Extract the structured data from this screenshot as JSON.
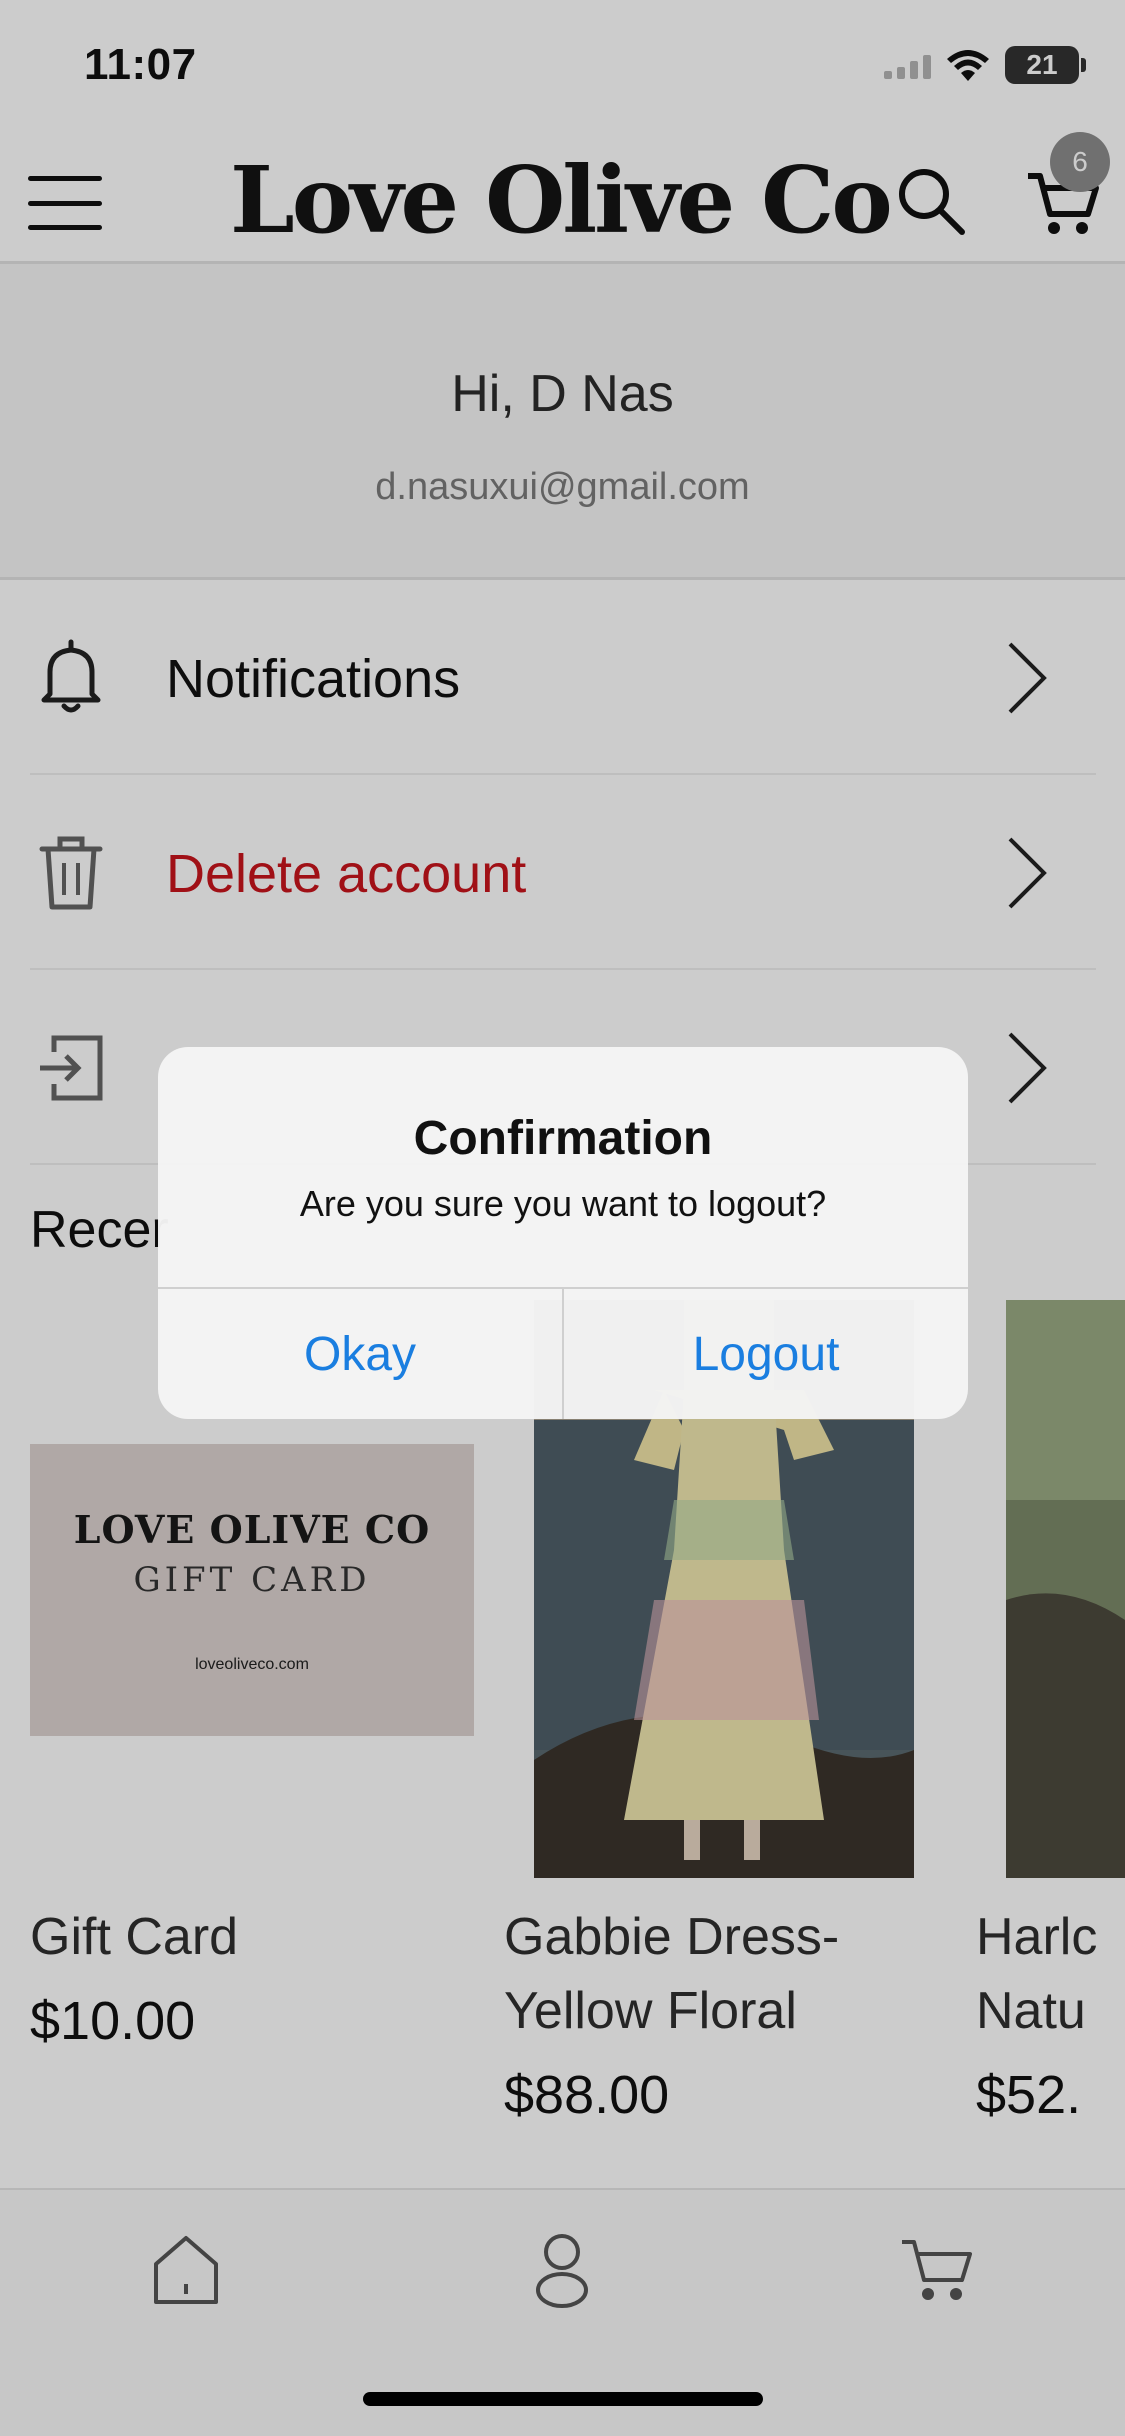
{
  "status_bar": {
    "time": "11:07",
    "battery": "21"
  },
  "header": {
    "brand": "Love Olive Co",
    "cart_count": "6"
  },
  "profile": {
    "greeting": "Hi, D Nas",
    "email": "d.nasuxui@gmail.com"
  },
  "menu": [
    {
      "label": "Notifications",
      "icon": "bell-icon",
      "color": "#111111"
    },
    {
      "label": "Delete account",
      "icon": "trash-icon",
      "color": "#c8141c"
    },
    {
      "label": "",
      "icon": "logout-icon",
      "color": "#c8141c"
    }
  ],
  "recent": {
    "title": "Recer",
    "products": [
      {
        "name": "Gift Card",
        "price": "$10.00",
        "image_lines": [
          "LOVE OLIVE CO",
          "GIFT CARD",
          "loveoliveco.com"
        ]
      },
      {
        "name_lines": [
          "Gabbie Dress-",
          "Yellow Floral"
        ],
        "price": "$88.00"
      },
      {
        "name_lines": [
          "Harlc",
          "Natu"
        ],
        "price": "$52."
      }
    ]
  },
  "dialog": {
    "title": "Confirmation",
    "message": "Are you sure you want to logout?",
    "okay_label": "Okay",
    "logout_label": "Logout"
  },
  "tabbar": {
    "tabs": [
      "home-icon",
      "profile-icon",
      "cart-icon"
    ]
  },
  "colors": {
    "accent": "#1a7ee0",
    "danger": "#c8141c"
  }
}
